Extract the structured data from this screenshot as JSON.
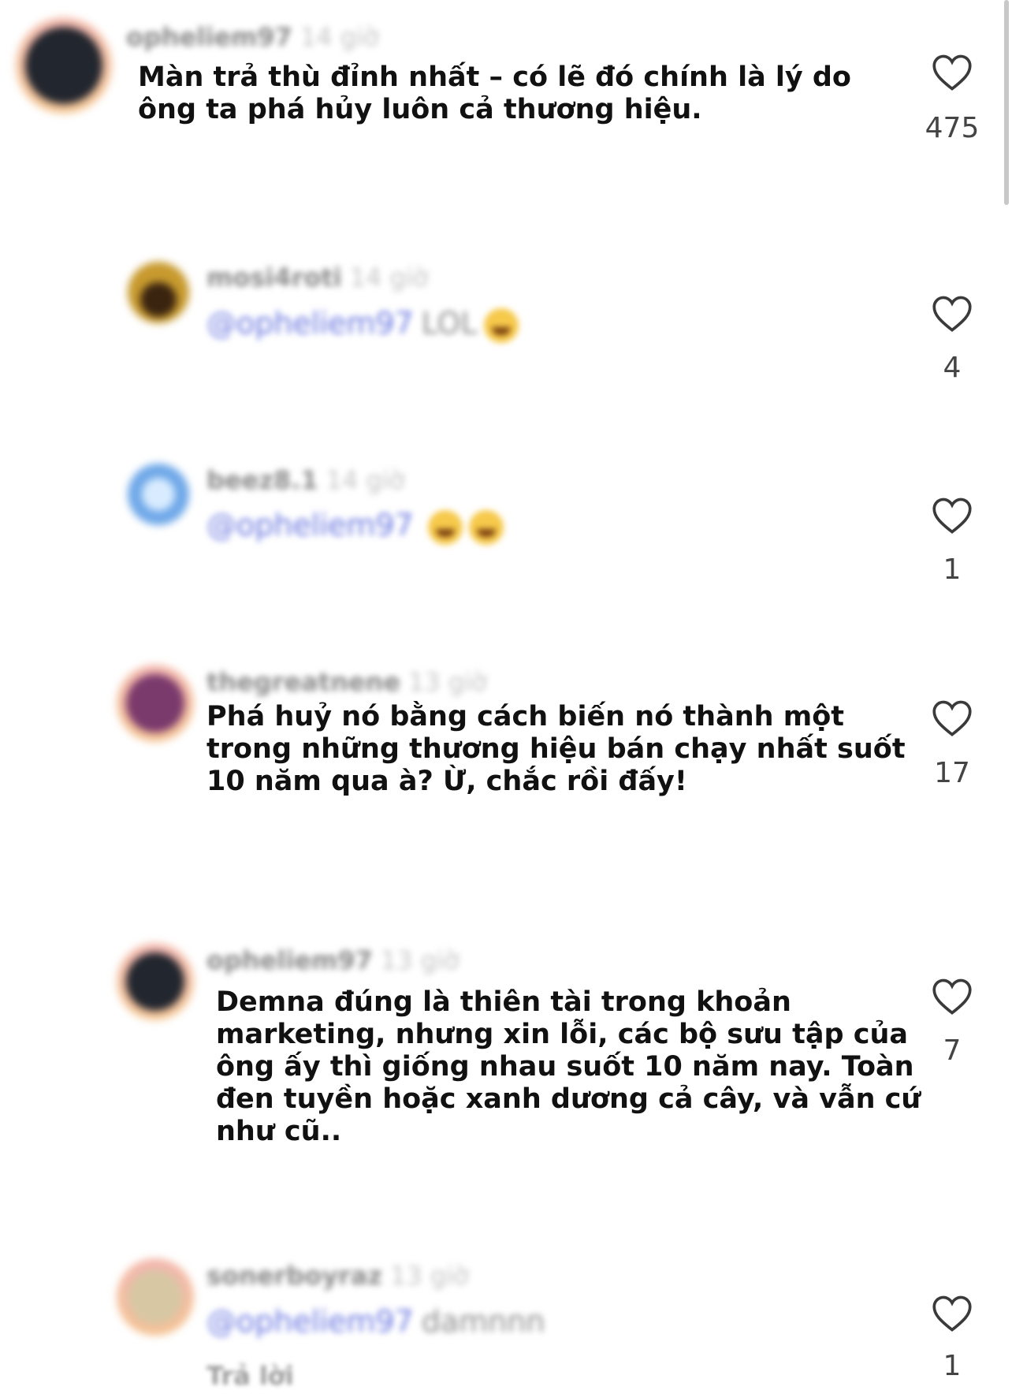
{
  "comments": [
    {
      "username": "opheliem97",
      "time": "14 giờ",
      "text_lines": [
        "Màn trả thù đỉnh nhất – có lẽ đó chính là lý do",
        "ông ta phá hủy luôn cả thương hiệu."
      ],
      "likes": "475"
    },
    {
      "username": "mosi4roti",
      "time": "14 giờ",
      "mention": "@opheliem97",
      "text": "LOL",
      "likes": "4"
    },
    {
      "username": "beez8.1",
      "time": "14 giờ",
      "mention": "@opheliem97",
      "text": "",
      "likes": "1"
    },
    {
      "username": "thegreatnene",
      "time": "13 giờ",
      "text_lines": [
        "Phá huỷ nó bằng cách biến nó thành một",
        "trong những thương hiệu bán chạy nhất suốt",
        "10 năm qua à? Ừ, chắc rồi đấy!"
      ],
      "likes": "17"
    },
    {
      "username": "opheliem97",
      "time": "13 giờ",
      "text_lines": [
        "Demna đúng là thiên tài trong khoản",
        "marketing, nhưng xin lỗi, các bộ sưu tập của",
        "ông ấy thì giống nhau suốt 10 năm nay. Toàn",
        "đen tuyền hoặc xanh dương cả cây, và vẫn cứ",
        "như cũ.."
      ],
      "likes": "7"
    },
    {
      "username": "sonerboyraz",
      "time": "13 giờ",
      "mention": "@opheliem97",
      "text": "damnnn",
      "reply_label": "Trả lời",
      "likes": "1"
    }
  ],
  "colors": {
    "mention": "#6b78e0",
    "heart_stroke": "#3a3a3a"
  },
  "icons": {
    "like": "heart-outline-icon",
    "reaction_emoji": "crying-laughing-emoji"
  }
}
